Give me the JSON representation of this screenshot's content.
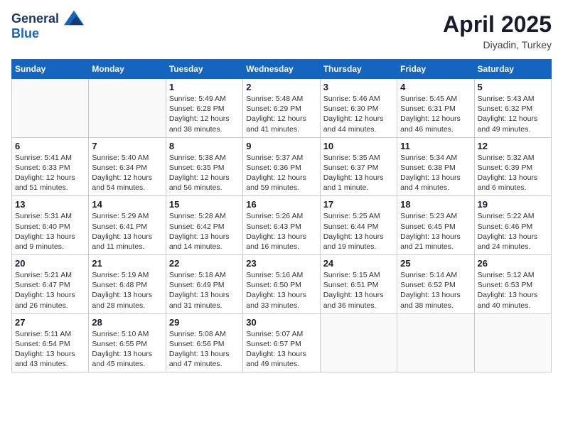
{
  "header": {
    "logo_line1": "General",
    "logo_line2": "Blue",
    "title": "April 2025",
    "subtitle": "Diyadin, Turkey"
  },
  "calendar": {
    "days_of_week": [
      "Sunday",
      "Monday",
      "Tuesday",
      "Wednesday",
      "Thursday",
      "Friday",
      "Saturday"
    ],
    "weeks": [
      [
        {
          "day": "",
          "info": ""
        },
        {
          "day": "",
          "info": ""
        },
        {
          "day": "1",
          "info": "Sunrise: 5:49 AM\nSunset: 6:28 PM\nDaylight: 12 hours and 38 minutes."
        },
        {
          "day": "2",
          "info": "Sunrise: 5:48 AM\nSunset: 6:29 PM\nDaylight: 12 hours and 41 minutes."
        },
        {
          "day": "3",
          "info": "Sunrise: 5:46 AM\nSunset: 6:30 PM\nDaylight: 12 hours and 44 minutes."
        },
        {
          "day": "4",
          "info": "Sunrise: 5:45 AM\nSunset: 6:31 PM\nDaylight: 12 hours and 46 minutes."
        },
        {
          "day": "5",
          "info": "Sunrise: 5:43 AM\nSunset: 6:32 PM\nDaylight: 12 hours and 49 minutes."
        }
      ],
      [
        {
          "day": "6",
          "info": "Sunrise: 5:41 AM\nSunset: 6:33 PM\nDaylight: 12 hours and 51 minutes."
        },
        {
          "day": "7",
          "info": "Sunrise: 5:40 AM\nSunset: 6:34 PM\nDaylight: 12 hours and 54 minutes."
        },
        {
          "day": "8",
          "info": "Sunrise: 5:38 AM\nSunset: 6:35 PM\nDaylight: 12 hours and 56 minutes."
        },
        {
          "day": "9",
          "info": "Sunrise: 5:37 AM\nSunset: 6:36 PM\nDaylight: 12 hours and 59 minutes."
        },
        {
          "day": "10",
          "info": "Sunrise: 5:35 AM\nSunset: 6:37 PM\nDaylight: 13 hours and 1 minute."
        },
        {
          "day": "11",
          "info": "Sunrise: 5:34 AM\nSunset: 6:38 PM\nDaylight: 13 hours and 4 minutes."
        },
        {
          "day": "12",
          "info": "Sunrise: 5:32 AM\nSunset: 6:39 PM\nDaylight: 13 hours and 6 minutes."
        }
      ],
      [
        {
          "day": "13",
          "info": "Sunrise: 5:31 AM\nSunset: 6:40 PM\nDaylight: 13 hours and 9 minutes."
        },
        {
          "day": "14",
          "info": "Sunrise: 5:29 AM\nSunset: 6:41 PM\nDaylight: 13 hours and 11 minutes."
        },
        {
          "day": "15",
          "info": "Sunrise: 5:28 AM\nSunset: 6:42 PM\nDaylight: 13 hours and 14 minutes."
        },
        {
          "day": "16",
          "info": "Sunrise: 5:26 AM\nSunset: 6:43 PM\nDaylight: 13 hours and 16 minutes."
        },
        {
          "day": "17",
          "info": "Sunrise: 5:25 AM\nSunset: 6:44 PM\nDaylight: 13 hours and 19 minutes."
        },
        {
          "day": "18",
          "info": "Sunrise: 5:23 AM\nSunset: 6:45 PM\nDaylight: 13 hours and 21 minutes."
        },
        {
          "day": "19",
          "info": "Sunrise: 5:22 AM\nSunset: 6:46 PM\nDaylight: 13 hours and 24 minutes."
        }
      ],
      [
        {
          "day": "20",
          "info": "Sunrise: 5:21 AM\nSunset: 6:47 PM\nDaylight: 13 hours and 26 minutes."
        },
        {
          "day": "21",
          "info": "Sunrise: 5:19 AM\nSunset: 6:48 PM\nDaylight: 13 hours and 28 minutes."
        },
        {
          "day": "22",
          "info": "Sunrise: 5:18 AM\nSunset: 6:49 PM\nDaylight: 13 hours and 31 minutes."
        },
        {
          "day": "23",
          "info": "Sunrise: 5:16 AM\nSunset: 6:50 PM\nDaylight: 13 hours and 33 minutes."
        },
        {
          "day": "24",
          "info": "Sunrise: 5:15 AM\nSunset: 6:51 PM\nDaylight: 13 hours and 36 minutes."
        },
        {
          "day": "25",
          "info": "Sunrise: 5:14 AM\nSunset: 6:52 PM\nDaylight: 13 hours and 38 minutes."
        },
        {
          "day": "26",
          "info": "Sunrise: 5:12 AM\nSunset: 6:53 PM\nDaylight: 13 hours and 40 minutes."
        }
      ],
      [
        {
          "day": "27",
          "info": "Sunrise: 5:11 AM\nSunset: 6:54 PM\nDaylight: 13 hours and 43 minutes."
        },
        {
          "day": "28",
          "info": "Sunrise: 5:10 AM\nSunset: 6:55 PM\nDaylight: 13 hours and 45 minutes."
        },
        {
          "day": "29",
          "info": "Sunrise: 5:08 AM\nSunset: 6:56 PM\nDaylight: 13 hours and 47 minutes."
        },
        {
          "day": "30",
          "info": "Sunrise: 5:07 AM\nSunset: 6:57 PM\nDaylight: 13 hours and 49 minutes."
        },
        {
          "day": "",
          "info": ""
        },
        {
          "day": "",
          "info": ""
        },
        {
          "day": "",
          "info": ""
        }
      ]
    ]
  }
}
